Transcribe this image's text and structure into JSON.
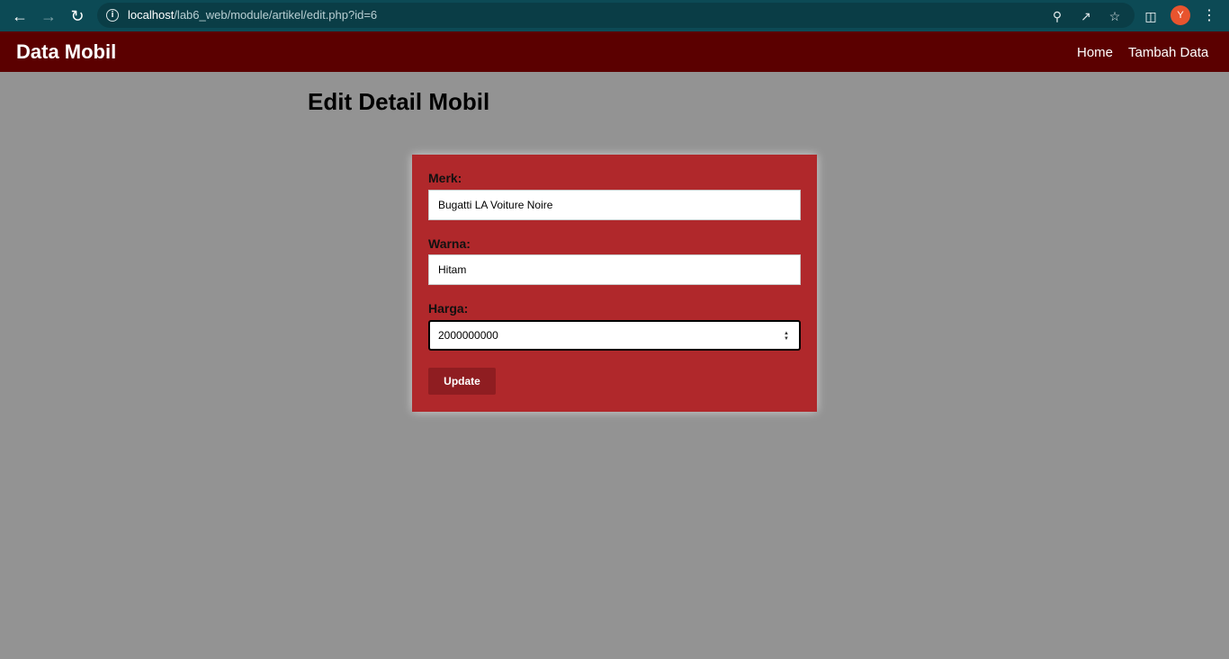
{
  "browser": {
    "url_host": "localhost",
    "url_path": "/lab6_web/module/artikel/edit.php?id=6",
    "profile_initial": "Y",
    "icons": [
      "back-icon",
      "forward-icon",
      "reload-icon",
      "info-icon",
      "zoom-icon",
      "share-icon",
      "star-icon",
      "sidepanel-icon",
      "menu-icon"
    ]
  },
  "navbar": {
    "brand": "Data Mobil",
    "links": [
      "Home",
      "Tambah Data"
    ]
  },
  "page": {
    "title": "Edit Detail Mobil"
  },
  "form": {
    "merk_label": "Merk:",
    "merk_value": "Bugatti LA Voiture Noire",
    "warna_label": "Warna:",
    "warna_value": "Hitam",
    "harga_label": "Harga:",
    "harga_value": "2000000000",
    "submit_label": "Update"
  },
  "colors": {
    "chrome": "#0c4a55",
    "navbar": "#5b0000",
    "background": "#939393",
    "card": "#b0282b",
    "button": "#8f1d21"
  }
}
